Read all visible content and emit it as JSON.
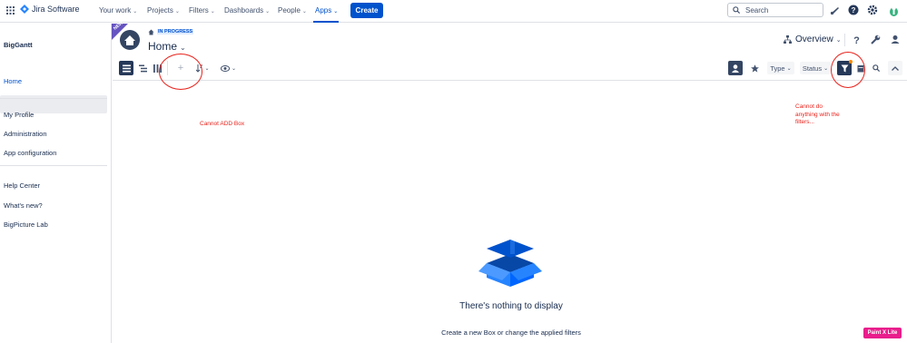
{
  "topnav": {
    "product": "Jira Software",
    "items": [
      {
        "label": "Your work",
        "caret": "⌄"
      },
      {
        "label": "Projects",
        "caret": "⌄"
      },
      {
        "label": "Filters",
        "caret": "⌄"
      },
      {
        "label": "Dashboards",
        "caret": "⌄"
      },
      {
        "label": "People",
        "caret": "⌄"
      },
      {
        "label": "Apps",
        "caret": "⌄"
      }
    ],
    "create_label": "Create",
    "search_placeholder": "Search",
    "colors": {
      "brand": "#0052cc",
      "active": "#0052cc"
    }
  },
  "sidebar": {
    "app_name": "BigGantt",
    "items": [
      {
        "label": "Home",
        "active": true
      },
      {
        "label": "My Profile"
      },
      {
        "label": "Administration"
      },
      {
        "label": "App configuration"
      },
      {
        "label": "Help Center"
      },
      {
        "label": "What's new?"
      },
      {
        "label": "BigPicture Lab"
      }
    ]
  },
  "header": {
    "badge_new": "NEW",
    "status": "IN PROGRESS",
    "title": "Home",
    "title_caret": "⌄",
    "view_label": "Overview",
    "view_caret": "⌄"
  },
  "toolbar": {
    "type_label": "Type",
    "status_label": "Status",
    "caret": "⌄",
    "add_glyph": "+"
  },
  "annotations": {
    "add_note": "Cannot ADD Box",
    "filter_note": [
      "Cannot do",
      "anything with the",
      "filters..."
    ],
    "color": "#e8231c"
  },
  "empty_state": {
    "title": "There's nothing to display",
    "subtitle": "Create a new Box or change the applied filters"
  },
  "watermark": "Paint X Lite"
}
